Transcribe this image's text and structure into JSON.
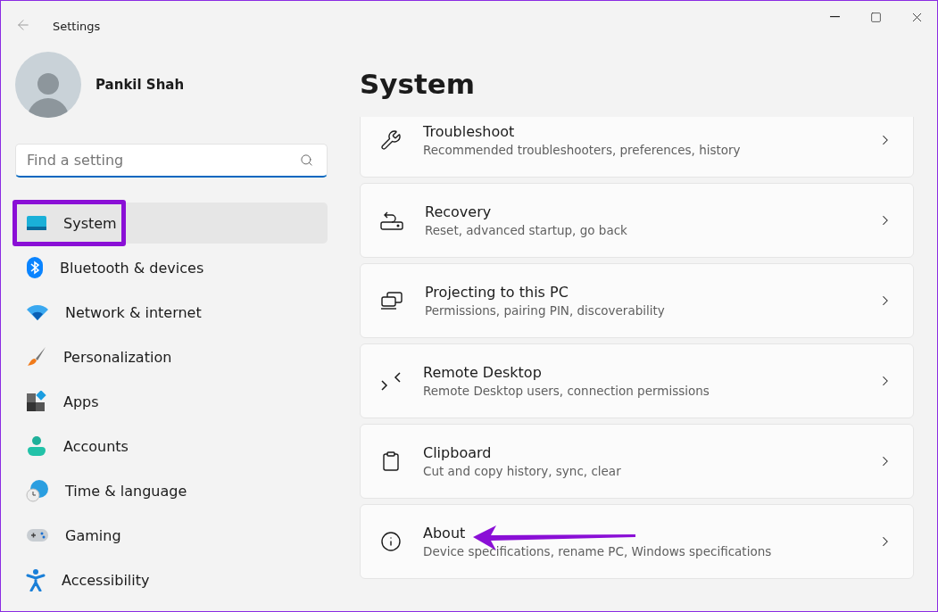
{
  "window": {
    "title": "Settings"
  },
  "user": {
    "name": "Pankil Shah"
  },
  "search": {
    "placeholder": "Find a setting"
  },
  "sidebar": {
    "items": [
      {
        "label": "System",
        "kind": "system",
        "selected": true,
        "highlighted": true
      },
      {
        "label": "Bluetooth & devices",
        "kind": "bluetooth",
        "selected": false,
        "highlighted": false
      },
      {
        "label": "Network & internet",
        "kind": "network",
        "selected": false,
        "highlighted": false
      },
      {
        "label": "Personalization",
        "kind": "brush",
        "selected": false,
        "highlighted": false
      },
      {
        "label": "Apps",
        "kind": "apps",
        "selected": false,
        "highlighted": false
      },
      {
        "label": "Accounts",
        "kind": "accounts",
        "selected": false,
        "highlighted": false
      },
      {
        "label": "Time & language",
        "kind": "time",
        "selected": false,
        "highlighted": false
      },
      {
        "label": "Gaming",
        "kind": "gaming",
        "selected": false,
        "highlighted": false
      },
      {
        "label": "Accessibility",
        "kind": "accessibility",
        "selected": false,
        "highlighted": false
      }
    ]
  },
  "page": {
    "title": "System",
    "cards": [
      {
        "title": "Troubleshoot",
        "subtitle": "Recommended troubleshooters, preferences, history",
        "kind": "wrench",
        "pointed": false
      },
      {
        "title": "Recovery",
        "subtitle": "Reset, advanced startup, go back",
        "kind": "recovery",
        "pointed": false
      },
      {
        "title": "Projecting to this PC",
        "subtitle": "Permissions, pairing PIN, discoverability",
        "kind": "project",
        "pointed": false
      },
      {
        "title": "Remote Desktop",
        "subtitle": "Remote Desktop users, connection permissions",
        "kind": "remote",
        "pointed": false
      },
      {
        "title": "Clipboard",
        "subtitle": "Cut and copy history, sync, clear",
        "kind": "clipboard",
        "pointed": false
      },
      {
        "title": "About",
        "subtitle": "Device specifications, rename PC, Windows specifications",
        "kind": "about",
        "pointed": true
      }
    ]
  }
}
